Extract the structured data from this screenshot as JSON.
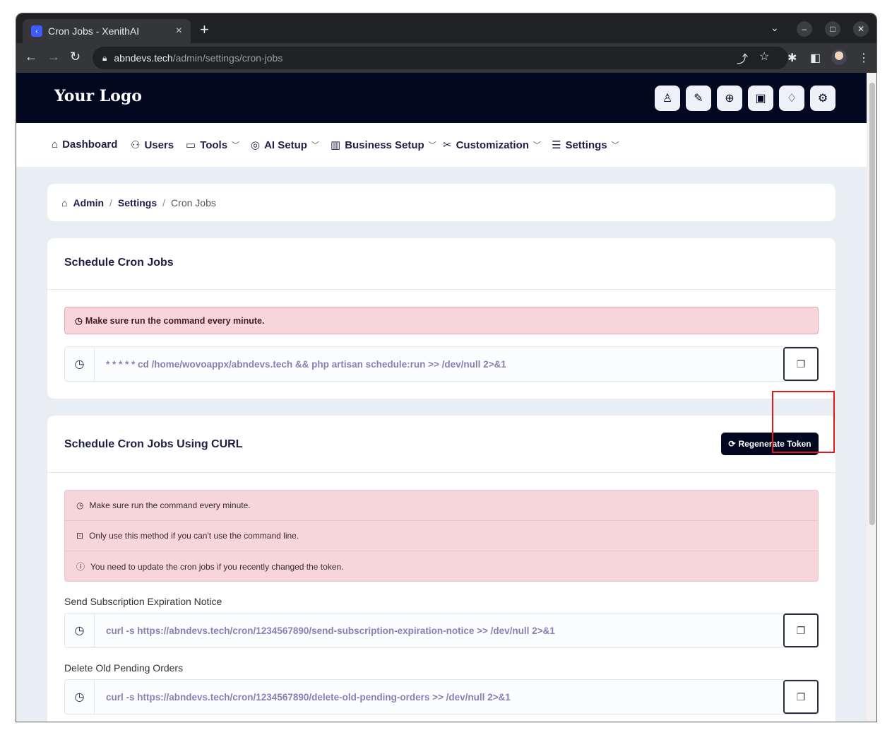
{
  "browser": {
    "tab_title": "Cron Jobs - XenithAI",
    "tab_close": "×",
    "new_tab": "+",
    "url_domain": "abndevs.tech",
    "url_path": "/admin/settings/cron-jobs"
  },
  "header": {
    "logo": "Your Logo",
    "icons": [
      "user-icon",
      "paint-icon",
      "globe-icon",
      "currency-icon",
      "bell-icon",
      "user-settings-icon"
    ]
  },
  "menu": {
    "items": [
      {
        "label": "Dashboard",
        "icon": "home-icon",
        "dropdown": false
      },
      {
        "label": "Users",
        "icon": "users-icon",
        "dropdown": false
      },
      {
        "label": "Tools",
        "icon": "briefcase-icon",
        "dropdown": true
      },
      {
        "label": "AI Setup",
        "icon": "ai-icon",
        "dropdown": true
      },
      {
        "label": "Business Setup",
        "icon": "building-icon",
        "dropdown": true
      },
      {
        "label": "Customization",
        "icon": "tools-icon",
        "dropdown": true
      },
      {
        "label": "Settings",
        "icon": "sliders-icon",
        "dropdown": true
      }
    ]
  },
  "breadcrumb": {
    "items": [
      "Admin",
      "Settings",
      "Cron Jobs"
    ],
    "separator": "/"
  },
  "schedule": {
    "title": "Schedule Cron Jobs",
    "alert": "Make sure run the command every minute.",
    "command": "* * * * * cd /home/wovoappx/abndevs.tech && php artisan schedule:run >> /dev/null 2>&1"
  },
  "curl": {
    "title": "Schedule Cron Jobs Using CURL",
    "regenerate_label": "Regenerate Token",
    "alerts": [
      "Make sure run the command every minute.",
      "Only use this method if you can't use the command line.",
      "You need to update the cron jobs if you recently changed the token."
    ],
    "jobs": [
      {
        "label": "Send Subscription Expiration Notice",
        "command": "curl -s https://abndevs.tech/cron/1234567890/send-subscription-expiration-notice >> /dev/null 2>&1"
      },
      {
        "label": "Delete Old Pending Orders",
        "command": "curl -s https://abndevs.tech/cron/1234567890/delete-old-pending-orders >> /dev/null 2>&1"
      }
    ]
  },
  "colors": {
    "header_bg": "#010820",
    "alert_bg": "#f6d5db",
    "highlight": "#e51818"
  }
}
